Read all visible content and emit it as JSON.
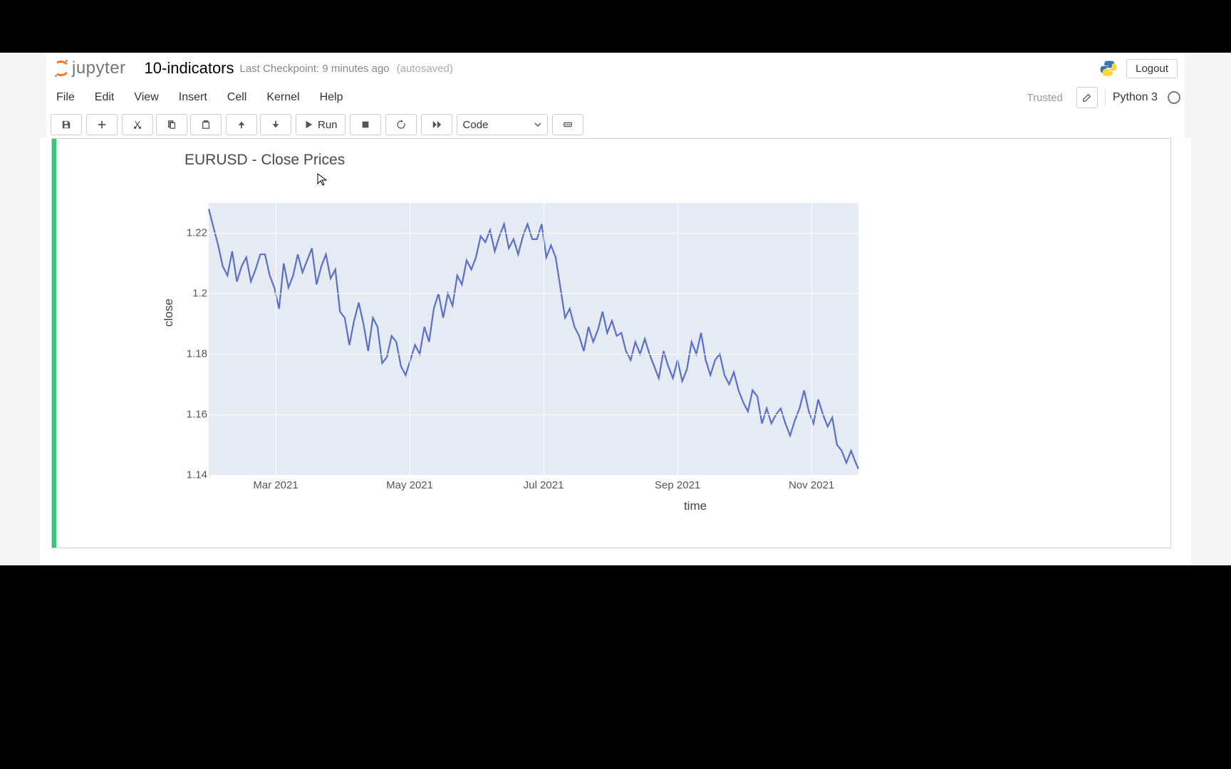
{
  "header": {
    "logo_text": "jupyter",
    "notebook_title": "10-indicators",
    "checkpoint": "Last Checkpoint: 9 minutes ago",
    "autosaved": "(autosaved)",
    "logout_label": "Logout"
  },
  "menubar": {
    "items": [
      "File",
      "Edit",
      "View",
      "Insert",
      "Cell",
      "Kernel",
      "Help"
    ],
    "trusted": "Trusted",
    "kernel": "Python 3"
  },
  "toolbar": {
    "run_label": "Run",
    "cell_type": "Code"
  },
  "chart_data": {
    "type": "line",
    "title": "EURUSD - Close Prices",
    "xlabel": "time",
    "ylabel": "close",
    "ylim": [
      1.14,
      1.23
    ],
    "y_ticks": [
      1.14,
      1.16,
      1.18,
      1.2,
      1.22
    ],
    "x_tick_labels": [
      "Mar 2021",
      "May 2021",
      "Jul 2021",
      "Sep 2021",
      "Nov 2021"
    ],
    "x_tick_positions_months": [
      2,
      4,
      6,
      8,
      10
    ],
    "x_range_months": [
      1,
      10.7
    ],
    "series": [
      {
        "name": "close",
        "x_month": [
          1.0,
          1.07,
          1.14,
          1.21,
          1.28,
          1.35,
          1.42,
          1.49,
          1.56,
          1.63,
          1.7,
          1.77,
          1.84,
          1.91,
          1.98,
          2.05,
          2.12,
          2.19,
          2.26,
          2.33,
          2.4,
          2.47,
          2.54,
          2.61,
          2.68,
          2.75,
          2.82,
          2.89,
          2.96,
          3.03,
          3.1,
          3.17,
          3.24,
          3.31,
          3.38,
          3.45,
          3.52,
          3.59,
          3.66,
          3.73,
          3.8,
          3.87,
          3.94,
          4.01,
          4.08,
          4.15,
          4.22,
          4.29,
          4.36,
          4.43,
          4.5,
          4.57,
          4.64,
          4.71,
          4.78,
          4.85,
          4.92,
          4.99,
          5.06,
          5.13,
          5.2,
          5.27,
          5.34,
          5.41,
          5.48,
          5.55,
          5.62,
          5.69,
          5.76,
          5.83,
          5.9,
          5.97,
          6.04,
          6.11,
          6.18,
          6.25,
          6.32,
          6.39,
          6.46,
          6.53,
          6.6,
          6.67,
          6.74,
          6.81,
          6.88,
          6.95,
          7.02,
          7.09,
          7.16,
          7.23,
          7.3,
          7.37,
          7.44,
          7.51,
          7.58,
          7.65,
          7.72,
          7.79,
          7.86,
          7.93,
          8.0,
          8.07,
          8.14,
          8.21,
          8.28,
          8.35,
          8.42,
          8.49,
          8.56,
          8.63,
          8.7,
          8.77,
          8.84,
          8.91,
          8.98,
          9.05,
          9.12,
          9.19,
          9.26,
          9.33,
          9.4,
          9.47,
          9.54,
          9.61,
          9.68,
          9.75,
          9.82,
          9.89,
          9.96,
          10.03,
          10.1,
          10.17,
          10.24,
          10.31,
          10.38,
          10.45,
          10.52,
          10.59,
          10.66,
          10.7
        ],
        "y": [
          1.228,
          1.222,
          1.216,
          1.209,
          1.206,
          1.214,
          1.204,
          1.209,
          1.212,
          1.204,
          1.208,
          1.213,
          1.213,
          1.206,
          1.202,
          1.195,
          1.21,
          1.202,
          1.206,
          1.213,
          1.207,
          1.211,
          1.215,
          1.203,
          1.209,
          1.213,
          1.205,
          1.208,
          1.194,
          1.192,
          1.183,
          1.191,
          1.197,
          1.19,
          1.181,
          1.192,
          1.189,
          1.177,
          1.179,
          1.186,
          1.184,
          1.176,
          1.173,
          1.178,
          1.183,
          1.18,
          1.189,
          1.184,
          1.195,
          1.2,
          1.192,
          1.2,
          1.196,
          1.206,
          1.203,
          1.211,
          1.208,
          1.212,
          1.219,
          1.217,
          1.221,
          1.214,
          1.219,
          1.223,
          1.215,
          1.218,
          1.213,
          1.219,
          1.223,
          1.218,
          1.218,
          1.223,
          1.212,
          1.216,
          1.212,
          1.202,
          1.192,
          1.195,
          1.189,
          1.186,
          1.181,
          1.189,
          1.184,
          1.188,
          1.194,
          1.187,
          1.191,
          1.186,
          1.187,
          1.181,
          1.178,
          1.184,
          1.18,
          1.185,
          1.18,
          1.176,
          1.172,
          1.181,
          1.176,
          1.172,
          1.178,
          1.171,
          1.175,
          1.184,
          1.18,
          1.187,
          1.178,
          1.173,
          1.178,
          1.18,
          1.173,
          1.17,
          1.174,
          1.168,
          1.164,
          1.161,
          1.168,
          1.166,
          1.157,
          1.162,
          1.157,
          1.16,
          1.162,
          1.157,
          1.153,
          1.158,
          1.162,
          1.168,
          1.161,
          1.157,
          1.165,
          1.16,
          1.156,
          1.159,
          1.15,
          1.148,
          1.144,
          1.148,
          1.144,
          1.142
        ]
      }
    ]
  }
}
